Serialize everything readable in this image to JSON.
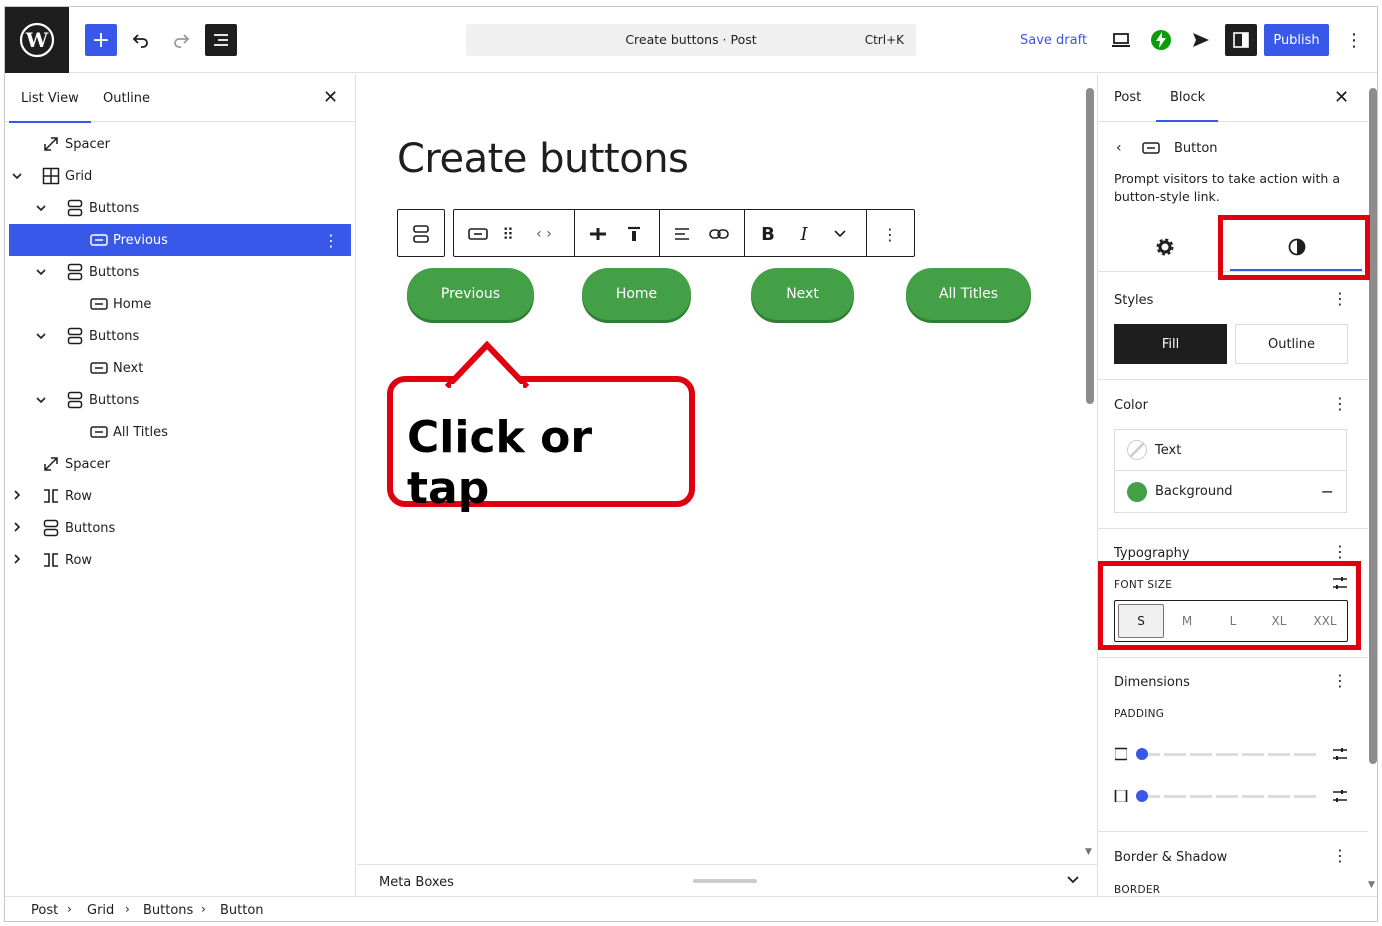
{
  "topbar": {
    "command_title": "Create buttons · Post",
    "command_shortcut": "Ctrl+K",
    "save_draft": "Save draft",
    "publish": "Publish"
  },
  "list_view": {
    "tabs": [
      "List View",
      "Outline"
    ],
    "items": [
      {
        "label": "Spacer",
        "depth": 0,
        "toggle": "",
        "icon": "spacer-icon"
      },
      {
        "label": "Grid",
        "depth": 0,
        "toggle": "⌄",
        "icon": "grid-icon"
      },
      {
        "label": "Buttons",
        "depth": 1,
        "toggle": "⌄",
        "icon": "buttons-icon"
      },
      {
        "label": "Previous",
        "depth": 2,
        "toggle": "",
        "icon": "button-icon",
        "selected": true
      },
      {
        "label": "Buttons",
        "depth": 1,
        "toggle": "⌄",
        "icon": "buttons-icon"
      },
      {
        "label": "Home",
        "depth": 2,
        "toggle": "",
        "icon": "button-icon"
      },
      {
        "label": "Buttons",
        "depth": 1,
        "toggle": "⌄",
        "icon": "buttons-icon"
      },
      {
        "label": "Next",
        "depth": 2,
        "toggle": "",
        "icon": "button-icon"
      },
      {
        "label": "Buttons",
        "depth": 1,
        "toggle": "⌄",
        "icon": "buttons-icon"
      },
      {
        "label": "All Titles",
        "depth": 2,
        "toggle": "",
        "icon": "button-icon"
      },
      {
        "label": "Spacer",
        "depth": 0,
        "toggle": "",
        "icon": "spacer-icon"
      },
      {
        "label": "Row",
        "depth": 0,
        "toggle": "›",
        "icon": "row-icon"
      },
      {
        "label": "Buttons",
        "depth": 0,
        "toggle": "›",
        "icon": "buttons-icon"
      },
      {
        "label": "Row",
        "depth": 0,
        "toggle": "›",
        "icon": "row-icon"
      }
    ]
  },
  "canvas": {
    "post_title": "Create buttons",
    "buttons": [
      "Previous",
      "Home",
      "Next",
      "All Titles"
    ],
    "button_color": "#43a047",
    "callout": "Click or tap"
  },
  "meta_boxes": {
    "label": "Meta Boxes"
  },
  "breadcrumb": [
    "Post",
    "Grid",
    "Buttons",
    "Button"
  ],
  "sidebar": {
    "tabs": [
      "Post",
      "Block"
    ],
    "block_name": "Button",
    "block_description": "Prompt visitors to take action with a button-style link.",
    "styles": {
      "title": "Styles",
      "options": [
        "Fill",
        "Outline"
      ]
    },
    "color": {
      "title": "Color",
      "text_label": "Text",
      "background_label": "Background",
      "background_swatch": "#43a047"
    },
    "typography": {
      "title": "Typography",
      "font_size_label": "FONT SIZE",
      "sizes": [
        "S",
        "M",
        "L",
        "XL",
        "XXL"
      ],
      "selected": "S"
    },
    "dimensions": {
      "title": "Dimensions",
      "padding_label": "PADDING"
    },
    "border_shadow": {
      "title": "Border & Shadow",
      "border_label": "BORDER"
    }
  },
  "accent_color": "#3858e9",
  "highlight_color": "#e00010"
}
